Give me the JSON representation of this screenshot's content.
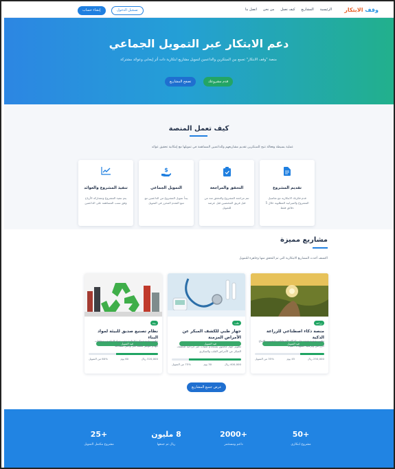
{
  "nav": {
    "logo_main": "وقف",
    "logo_accent": "الابتكار",
    "items": [
      "الرئيسية",
      "المشاريع",
      "كيف نعمل",
      "من نحن",
      "اتصل بنا"
    ],
    "login": "تسجيل الدخول",
    "signup": "إنشاء حساب"
  },
  "hero": {
    "title": "دعم الابتكار عبر التمويل الجماعي",
    "subtitle": "منصة \"وقف الابتكار\" تجمع بين المبتكرين والداعمين لتمويل مشاريع ابتكارية ذات أثر إيجابي وعوائد مشتركة",
    "btn_propose": "قدم مشروعك",
    "btn_browse": "تصفح المشاريع"
  },
  "how": {
    "title": "كيف تعمل المنصة",
    "description": "عملية بسيطة وفعالة تتيح للمبتكرين تقديم مشاريعهم وللداعمين المساهمة في تمويلها مع إمكانية تحقيق عوائد",
    "cards": [
      {
        "icon": "document-icon",
        "title": "تقديم المشروع",
        "desc": "قدم فكرتك الابتكارية مع تفاصيل المشروع والميزانية المطلوبة خلال 5 دقائق فقط"
      },
      {
        "icon": "clipboard-check-icon",
        "title": "التحقق والمراجعة",
        "desc": "تتم مراجعة المشروع والتحقق منه من قبل فريق المختصين قبل عرضه للتمويل"
      },
      {
        "icon": "hand-coin-icon",
        "title": "التمويل الجماعي",
        "desc": "يبدأ تمويل المشروع من الداعمين مع تتبع التقدم المحرز في التمويل"
      },
      {
        "icon": "chart-line-icon",
        "title": "تنفيذ المشروع والعوائد",
        "desc": "يتم تنفيذ المشروع ومشاركة الأرباح وفق نسب المساهمة على الداعمين"
      }
    ]
  },
  "featured": {
    "title": "مشاريع مميزة",
    "description": "اكتشف أحدث المشاريع الابتكارية التي تم التحقق منها وجاهزة للتمويل",
    "projects": [
      {
        "category": "زراعة",
        "status": "قيد التمويل",
        "title": "منصة ذكاء اصطناعي للزراعة الذكية",
        "desc": "تطوير منصة تعتمد على الذكاء الاصطناعي لتحسين الإنتاج الزراعي وترشيد استهلاك المياه",
        "progress": 0.35,
        "funded": "35% من التمويل",
        "days": "45 يوم",
        "goal": "250,000 ريال"
      },
      {
        "category": "طب",
        "status": "قيد التمويل",
        "title": "جهاز طبي للكشف المبكر عن الأمراض المزمنة",
        "desc": "تطوير جهاز محمول يستخدم تقنيات غير جراحية للكشف المبكر عن الأمراض القلب والسكري",
        "progress": 0.75,
        "funded": "75% من التمويل",
        "days": "30 يوم",
        "goal": "400,000 ريال"
      },
      {
        "category": "بيئة",
        "status": "قيد التمويل",
        "title": "نظام تصنيع صديق للبيئة لمواد البناء",
        "desc": "تطوير تقنية مبتكرة لإعادة تدوير مواد البناء من مخلفات الهدم لتوفير تكلفة أقل وأكثر استدامة",
        "progress": 0.6,
        "funded": "60% من التمويل",
        "days": "60 يوم",
        "goal": "320,000 ريال"
      }
    ],
    "btn_all": "عرض جميع المشاريع"
  },
  "stats": [
    {
      "number": "+50",
      "label": "مشروع ابتكاري"
    },
    {
      "number": "+2000",
      "label": "داعم ومستثمر"
    },
    {
      "number": "8 مليون",
      "label": "ريال تم جمعها"
    },
    {
      "number": "+25",
      "label": "مشروع مكتمل التمويل"
    }
  ],
  "colors": {
    "primary": "#1f7fe0",
    "success": "#20a463",
    "accent": "#e8622a"
  }
}
